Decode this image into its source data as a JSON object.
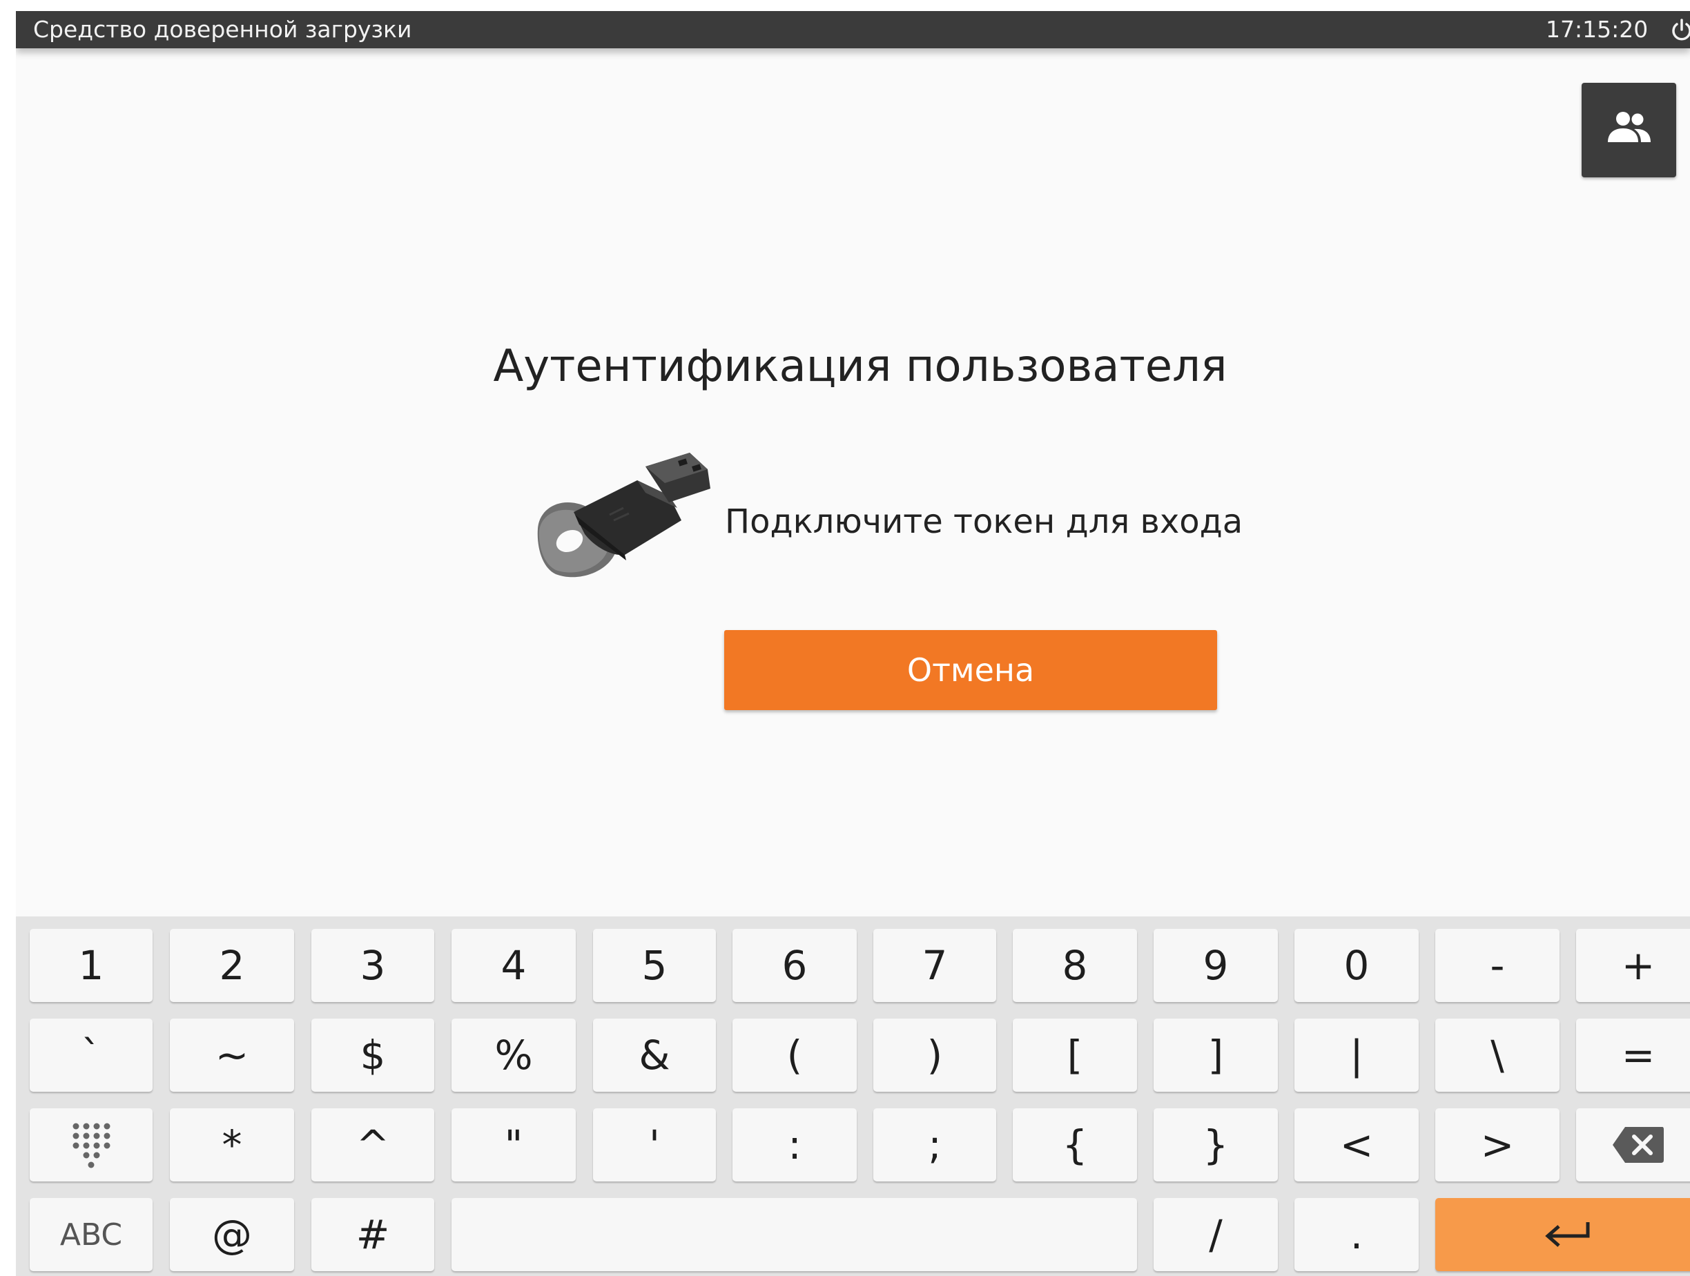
{
  "titlebar": {
    "app_title": "Средство доверенной загрузки",
    "time": "17:15:20",
    "power_icon": "power-icon"
  },
  "users_button": {
    "icon": "users-icon"
  },
  "auth": {
    "title": "Аутентификация пользователя",
    "token_image": "usb-token",
    "message": "Подключите токен для входа",
    "cancel_label": "Отмена"
  },
  "keyboard": {
    "row1": [
      "1",
      "2",
      "3",
      "4",
      "5",
      "6",
      "7",
      "8",
      "9",
      "0",
      "-",
      "+"
    ],
    "row2": [
      "`",
      "~",
      "$",
      "%",
      "&",
      "(",
      ")",
      "[",
      "]",
      "|",
      "\\",
      "="
    ],
    "row3": [
      "numpad-icon",
      "*",
      "^",
      "\"",
      "'",
      ":",
      ";",
      "{",
      "}",
      "<",
      ">",
      "backspace-icon"
    ],
    "row4": {
      "abc": "ABC",
      "at": "@",
      "hash": "#",
      "space": "",
      "slash": "/",
      "dot": ".",
      "enter": "enter-icon"
    }
  },
  "colors": {
    "accent": "#f27824",
    "enter_key": "#f79a4a",
    "titlebar": "#3b3b3b",
    "background": "#fafafa",
    "keyboard": "#e3e3e3"
  }
}
